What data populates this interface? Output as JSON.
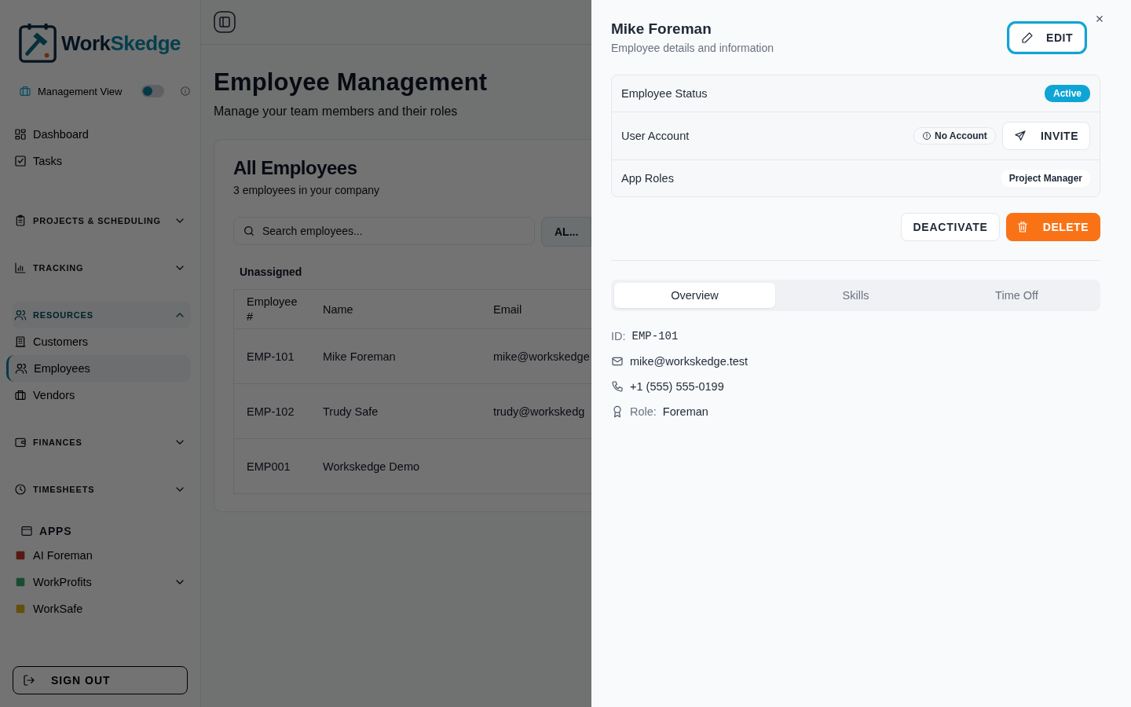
{
  "sidebar": {
    "logo": {
      "part_1": "Work",
      "part_2": "Skedge"
    },
    "view_toggle": {
      "label": "Management View",
      "on": false
    },
    "nav": [
      {
        "kind": "link",
        "label": "Dashboard"
      },
      {
        "kind": "link",
        "label": "Tasks"
      },
      {
        "kind": "section",
        "label": "PROJECTS & SCHEDULING",
        "expanded": false
      },
      {
        "kind": "section",
        "label": "TRACKING",
        "expanded": false
      },
      {
        "kind": "section",
        "label": "RESOURCES",
        "expanded": true,
        "children": [
          {
            "label": "Customers",
            "selected": false
          },
          {
            "label": "Employees",
            "selected": true
          },
          {
            "label": "Vendors",
            "selected": false
          }
        ]
      },
      {
        "kind": "section",
        "label": "FINANCES",
        "expanded": false
      },
      {
        "kind": "section",
        "label": "TIMESHEETS",
        "expanded": false
      },
      {
        "kind": "group",
        "label": "APPS",
        "children": [
          {
            "label": "AI Foreman",
            "expandable": false
          },
          {
            "label": "WorkProfits",
            "expandable": true
          },
          {
            "label": "WorkSafe",
            "expandable": false
          }
        ]
      }
    ],
    "sign_out": "SIGN OUT"
  },
  "page": {
    "title": "Employee Management",
    "subtitle": "Manage your team members and their roles",
    "card": {
      "title": "All Employees",
      "subtitle": "3 employees in your company",
      "search": {
        "placeholder": "Search employees..."
      },
      "filter": "AL...",
      "group": "Unassigned",
      "columns": [
        "Employee #",
        "Name",
        "Email"
      ],
      "rows": [
        [
          "EMP-101",
          "Mike Foreman",
          "mike@workskedge"
        ],
        [
          "EMP-102",
          "Trudy Safe",
          "trudy@workskedg"
        ],
        [
          "EMP001",
          "Workskedge Demo",
          ""
        ]
      ]
    }
  },
  "drawer": {
    "title": "Mike Foreman",
    "subtitle": "Employee details and information",
    "edit": "EDIT",
    "status_label": "Employee Status",
    "status": "Active",
    "account_label": "User Account",
    "account_status": "No Account",
    "invite": "INVITE",
    "roles_label": "App Roles",
    "roles": [
      "Project Manager"
    ],
    "deactivate": "DEACTIVATE",
    "delete": "DELETE",
    "tabs": [
      {
        "label": "Overview",
        "selected": true
      },
      {
        "label": "Skills",
        "selected": false
      },
      {
        "label": "Time Off",
        "selected": false
      }
    ],
    "details": {
      "id_label": "ID:",
      "id": "EMP-101",
      "email": "mike@workskedge.test",
      "phone": "+1 (555) 555-0199",
      "role_label": "Role:",
      "role": "Foreman"
    }
  }
}
